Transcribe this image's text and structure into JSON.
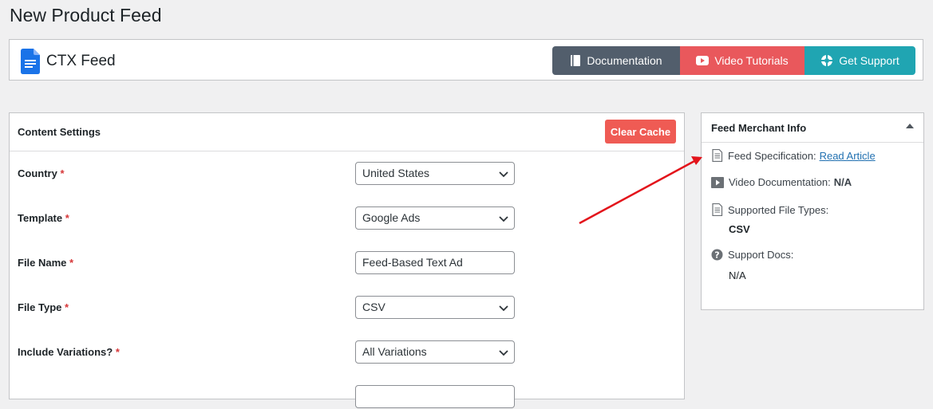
{
  "page_title": "New Product Feed",
  "brand": {
    "name": "CTX Feed",
    "icon": "document-icon"
  },
  "toolbar": {
    "documentation": "Documentation",
    "video_tutorials": "Video Tutorials",
    "get_support": "Get Support"
  },
  "content_settings": {
    "title": "Content Settings",
    "clear_cache": "Clear Cache",
    "fields": {
      "country": {
        "label": "Country",
        "value": "United States"
      },
      "template": {
        "label": "Template",
        "value": "Google Ads"
      },
      "file_name": {
        "label": "File Name",
        "value": "Feed-Based Text Ad"
      },
      "file_type": {
        "label": "File Type",
        "value": "CSV"
      },
      "include_variations": {
        "label": "Include Variations?",
        "value": "All Variations"
      }
    },
    "required_mark": "*"
  },
  "merchant_info": {
    "title": "Feed Merchant Info",
    "feed_spec_label": "Feed Specification:",
    "feed_spec_link": "Read Article",
    "video_doc_label": "Video Documentation:",
    "video_doc_value": "N/A",
    "file_types_label": "Supported File Types:",
    "file_types_value": "CSV",
    "support_docs_label": "Support Docs:",
    "support_docs_value": "N/A"
  },
  "colors": {
    "doc_button": "#525e6c",
    "video_button": "#e9585c",
    "support_button": "#20a5b2",
    "clear_cache": "#ef5b54",
    "annotation_arrow": "#e3141b"
  }
}
